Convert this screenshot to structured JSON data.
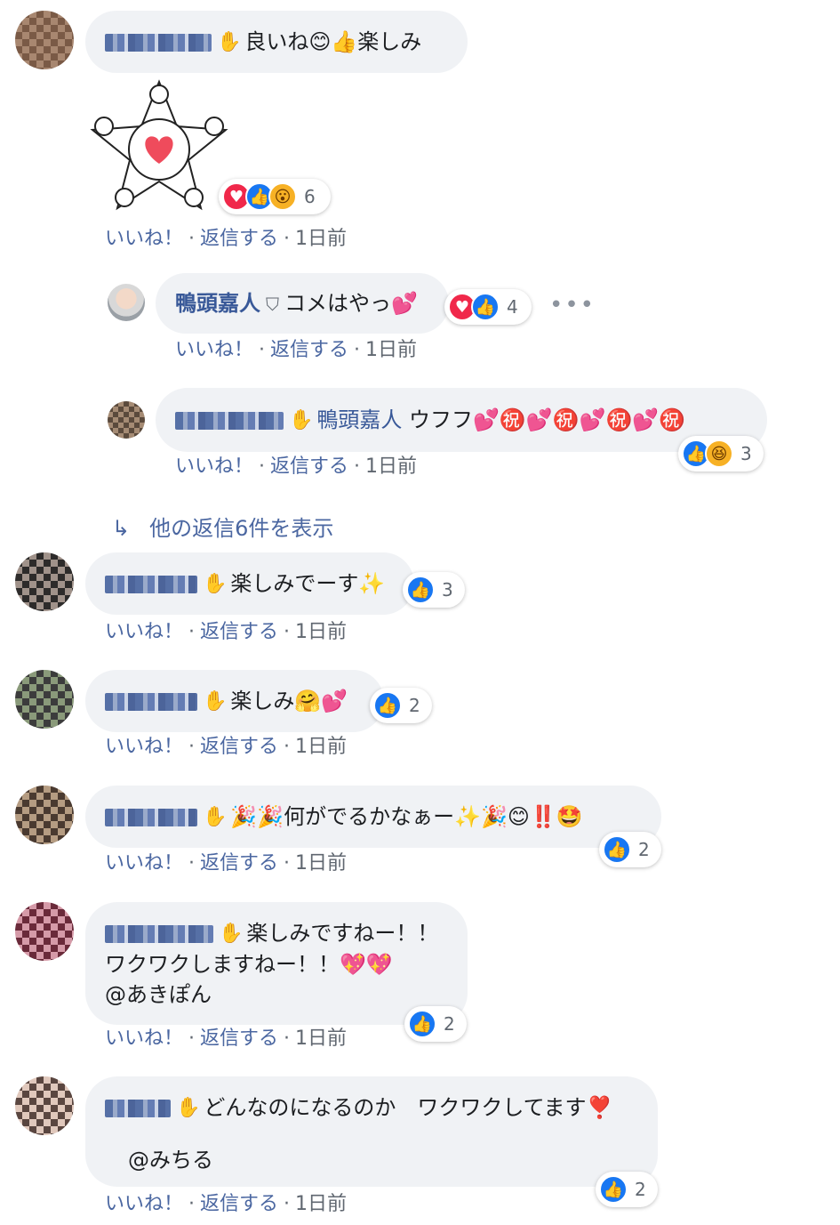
{
  "colors": {
    "bubble": "#f0f2f5",
    "link": "#4b67a1",
    "name": "#385898",
    "like": "#1877f2",
    "love": "#f0284a",
    "meta": "#606770"
  },
  "actions": {
    "like": "いいね！",
    "reply": "返信する",
    "time": "1日前",
    "sep": "·"
  },
  "comments": [
    {
      "text": "良いね😊👍楽しみ",
      "reactions": {
        "icons": [
          "love",
          "like",
          "wow"
        ],
        "count": "6"
      }
    },
    {
      "text": "楽しみでーす✨",
      "reactions": {
        "icons": [
          "like"
        ],
        "count": "3"
      }
    },
    {
      "text": "楽しみ🤗💕",
      "reactions": {
        "icons": [
          "like"
        ],
        "count": "2"
      }
    },
    {
      "text": "🎉🎉何がでるかなぁー✨🎉😊‼️🤩",
      "reactions": {
        "icons": [
          "like"
        ],
        "count": "2"
      }
    },
    {
      "line1": "楽しみですねー！！",
      "line2": "ワクワクしますねー！！💖💖",
      "line3": "@あきぽん",
      "reactions": {
        "icons": [
          "like"
        ],
        "count": "2"
      }
    },
    {
      "line1": "どんなのになるのか　ワクワクしてます❣️",
      "line3": "@みちる",
      "reactions": {
        "icons": [
          "like"
        ],
        "count": "2"
      }
    }
  ],
  "replies": [
    {
      "name": "鴨頭嘉人",
      "text": "コメはやっ💕",
      "reactions": {
        "icons": [
          "love",
          "like"
        ],
        "count": "4"
      }
    },
    {
      "mention": "鴨頭嘉人",
      "text": "ウフフ💕㊗️💕㊗️💕㊗️💕㊗️",
      "reactions": {
        "icons": [
          "like",
          "haha"
        ],
        "count": "3"
      }
    }
  ],
  "view_more": "他の返信6件を表示",
  "icons": {
    "wave": "wave-hand-icon",
    "verified": "shield-icon",
    "more": "more-options-icon",
    "reply_arrow": "reply-arrow-icon"
  }
}
